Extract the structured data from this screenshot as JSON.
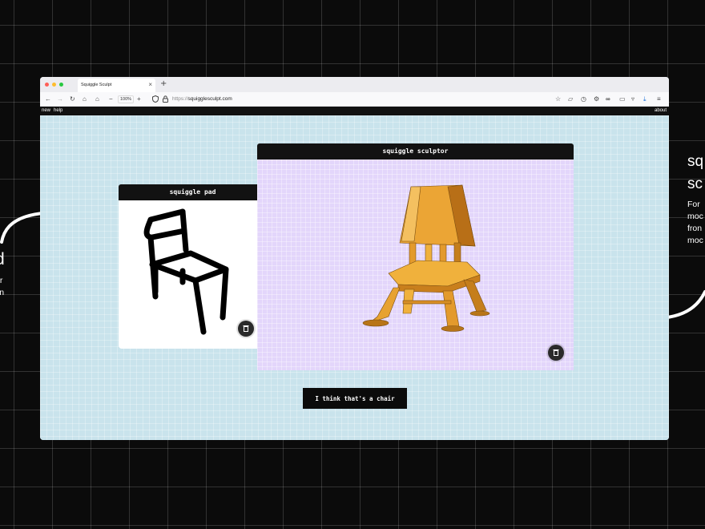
{
  "left_caption": {
    "title": "d",
    "lines": [
      "ur",
      "vn"
    ]
  },
  "right_caption": {
    "title_lines": [
      "sq",
      "sc"
    ],
    "lines": [
      "For",
      "moc",
      "fron",
      "moc"
    ]
  },
  "browser": {
    "tab_title": "Squiggle Sculpt",
    "tab_close": "×",
    "new_tab": "+",
    "zoom": "100%",
    "url_protocol": "https://",
    "url_host": "squigglesculpt.com"
  },
  "appbar": {
    "new": "new",
    "help": "help",
    "about": "about"
  },
  "pad": {
    "title": "squiggle pad"
  },
  "sculptor": {
    "title": "squiggle sculptor"
  },
  "action": {
    "label": "I think that's a chair"
  },
  "colors": {
    "chair": "#f0b13c",
    "pad_bg": "#ffffff",
    "sculptor_bg": "#e3d6fb",
    "canvas_bg": "#c9e3ec"
  }
}
